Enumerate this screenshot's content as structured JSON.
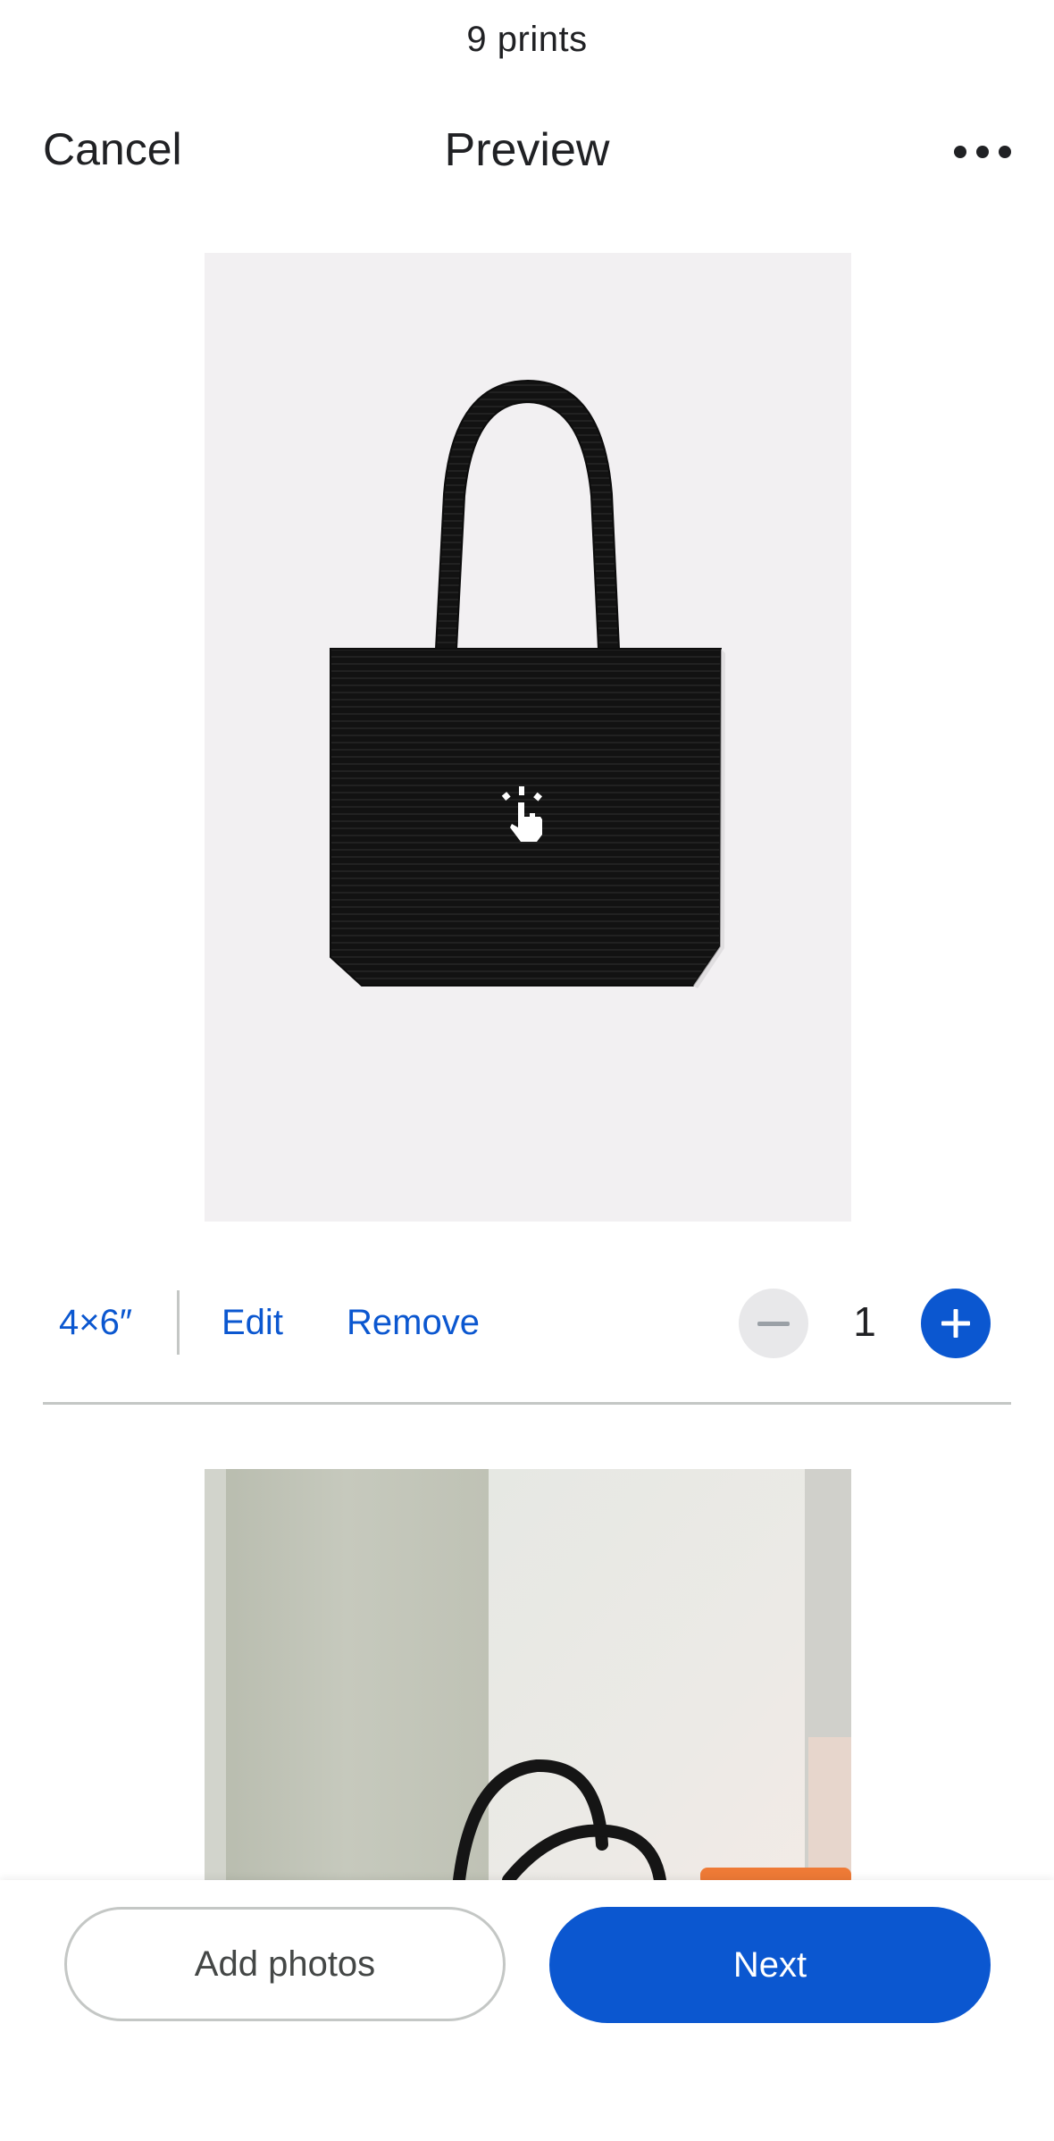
{
  "header": {
    "print_count": "9 prints",
    "cancel_label": "Cancel",
    "title": "Preview",
    "more_icon": "more-horizontal-icon"
  },
  "prints": [
    {
      "image": "black-tote-bag-photo",
      "overlay_icon": "tap-hand-icon",
      "size_label": "4×6″",
      "edit_label": "Edit",
      "remove_label": "Remove",
      "quantity": "1",
      "minus_icon": "minus-icon",
      "plus_icon": "plus-icon"
    },
    {
      "image": "tote-bag-on-shelf-photo"
    }
  ],
  "actions": {
    "add_photos_label": "Add photos",
    "next_label": "Next"
  },
  "colors": {
    "accent": "#0b57d0",
    "disabled_button": "#e8e8ea",
    "divider": "#c4c7c5"
  }
}
